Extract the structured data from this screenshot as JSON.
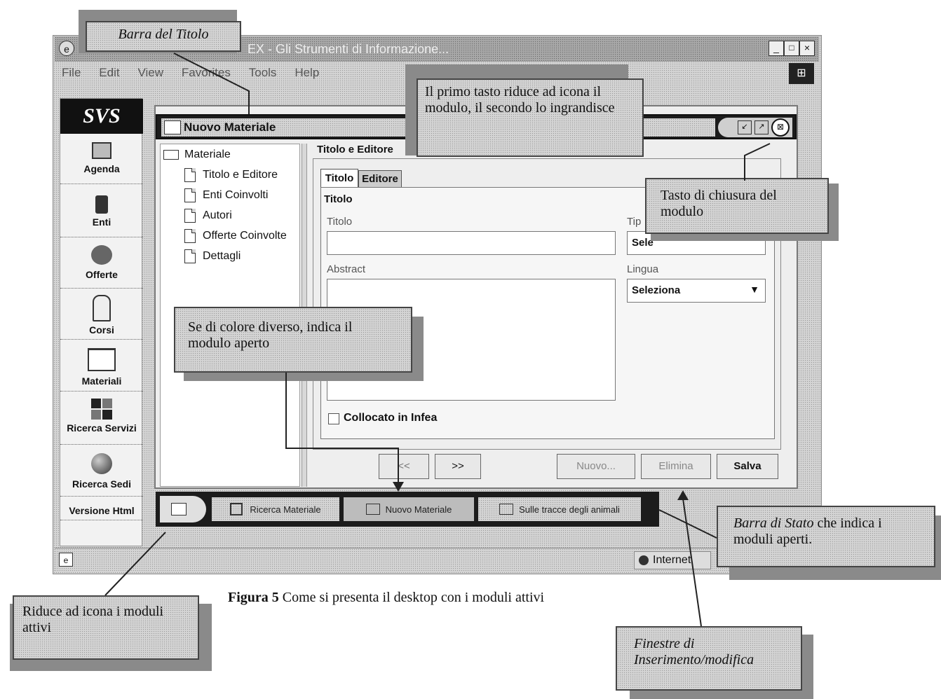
{
  "window": {
    "title_fragment": "EX - Gli Strumenti di Informazione...",
    "menus": [
      "File",
      "Edit",
      "View",
      "Favorites",
      "Tools",
      "Help"
    ]
  },
  "sidebar": {
    "logo": "SVS",
    "items": [
      {
        "label": "Agenda",
        "icon": "calendar-icon"
      },
      {
        "label": "Enti",
        "icon": "building-icon"
      },
      {
        "label": "Offerte",
        "icon": "people-icon"
      },
      {
        "label": "Corsi",
        "icon": "teacher-icon"
      },
      {
        "label": "Materiali",
        "icon": "book-icon"
      },
      {
        "label": "Ricerca Servizi",
        "icon": "arrows-grid-icon"
      },
      {
        "label": "Ricerca Sedi",
        "icon": "globe-icon"
      },
      {
        "label": "Versione Html",
        "icon": ""
      }
    ]
  },
  "module": {
    "title": "Nuovo Materiale",
    "tree": {
      "root": "Materiale",
      "children": [
        "Titolo e Editore",
        "Enti Coinvolti",
        "Autori",
        "Offerte Coinvolte",
        "Dettagli"
      ]
    },
    "panel_title": "Titolo e Editore",
    "tabs": [
      "Titolo",
      "Editore"
    ],
    "group_title": "Titolo",
    "fields": {
      "titolo_label": "Titolo",
      "tipo_label": "Tip",
      "tipo_value": "Sele",
      "abstract_label": "Abstract",
      "lingua_label": "Lingua",
      "lingua_value": "Seleziona",
      "checkbox_label": "Collocato in Infea"
    },
    "buttons": {
      "prev": "<<",
      "next": ">>",
      "nuovo": "Nuovo...",
      "elimina": "Elimina",
      "salva": "Salva"
    }
  },
  "taskbar": {
    "items": [
      "Ricerca Materiale",
      "Nuovo Materiale",
      "Sulle tracce degli animali"
    ]
  },
  "statusbar": {
    "zone": "Internet"
  },
  "callouts": {
    "barra_titolo": "Barra del Titolo",
    "primo_tasto": "Il primo tasto riduce ad icona il modulo, il secondo lo ingrandisce",
    "tasto_chiusura": "Tasto di chiusura del modulo",
    "colore_diverso": "Se di colore diverso, indica il modulo aperto",
    "barra_stato_em": "Barra di Stato",
    "barra_stato_rest": " che indica i moduli aperti.",
    "riduce_icona": "Riduce ad icona i moduli attivi",
    "finestre": "Finestre di Inserimento/modifica"
  },
  "caption": {
    "bold": "Figura 5",
    "text": " Come si presenta il  desktop con i moduli attivi"
  }
}
